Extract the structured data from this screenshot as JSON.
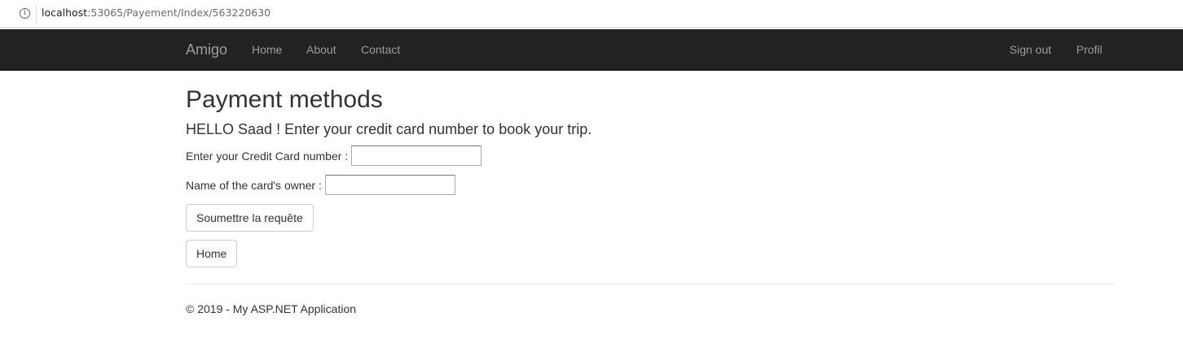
{
  "browser": {
    "info_icon": "info-icon",
    "url_host": "localhost",
    "url_path": ":53065/Payement/Index/563220630"
  },
  "navbar": {
    "brand": "Amigo",
    "links": [
      "Home",
      "About",
      "Contact"
    ],
    "right_links": [
      "Sign out",
      "Profil"
    ],
    "background": "#222222",
    "link_color": "#9d9d9d"
  },
  "main": {
    "title": "Payment methods",
    "greeting": "HELLO Saad ! Enter your credit card number to book your trip.",
    "card_label": "Enter your Credit Card number :",
    "card_value": "",
    "owner_label": "Name of the card's owner :",
    "owner_value": "",
    "submit_label": "Soumettre la requête",
    "home_label": "Home"
  },
  "footer": {
    "text": "© 2019 - My ASP.NET Application"
  }
}
